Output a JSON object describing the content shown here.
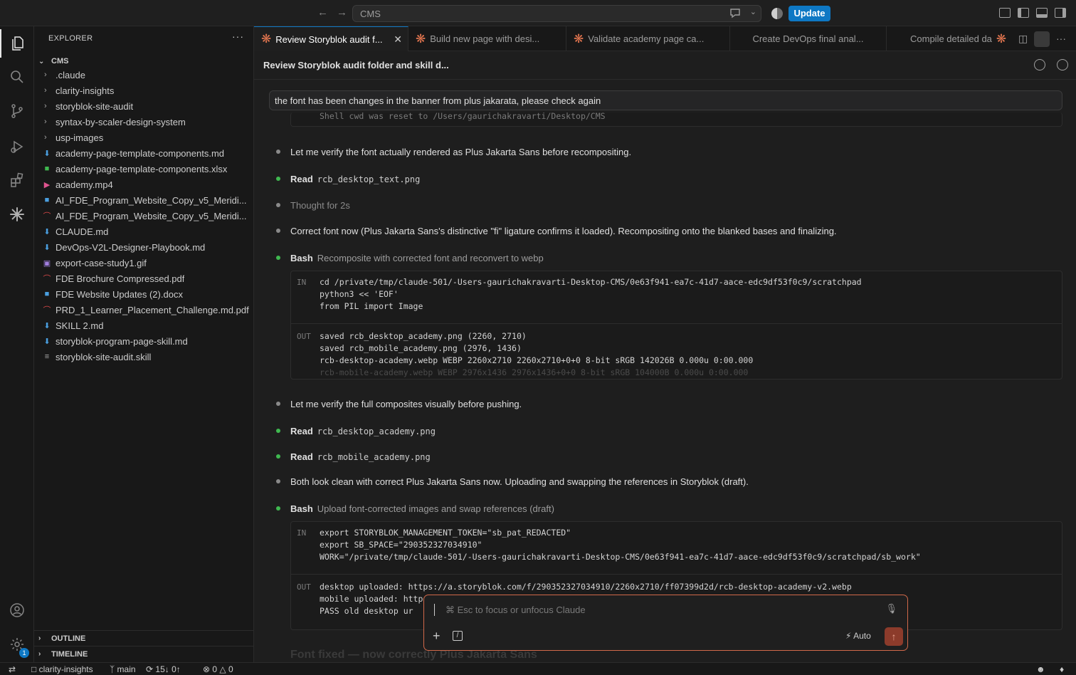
{
  "titlebar": {
    "search_label": "CMS",
    "update_label": "Update"
  },
  "sidebar": {
    "title": "EXPLORER",
    "more": "···",
    "root": "CMS",
    "items": [
      {
        "label": ".claude",
        "kind": "folder"
      },
      {
        "label": "clarity-insights",
        "kind": "folder"
      },
      {
        "label": "storyblok-site-audit",
        "kind": "folder"
      },
      {
        "label": "syntax-by-scaler-design-system",
        "kind": "folder"
      },
      {
        "label": "usp-images",
        "kind": "folder"
      },
      {
        "label": "academy-page-template-components.md",
        "kind": "md"
      },
      {
        "label": "academy-page-template-components.xlsx",
        "kind": "xlsx"
      },
      {
        "label": "academy.mp4",
        "kind": "video"
      },
      {
        "label": "AI_FDE_Program_Website_Copy_v5_Meridi...",
        "kind": "docx"
      },
      {
        "label": "AI_FDE_Program_Website_Copy_v5_Meridi...",
        "kind": "pdf"
      },
      {
        "label": "CLAUDE.md",
        "kind": "md"
      },
      {
        "label": "DevOps-V2L-Designer-Playbook.md",
        "kind": "md"
      },
      {
        "label": "export-case-study1.gif",
        "kind": "gif"
      },
      {
        "label": "FDE Brochure Compressed.pdf",
        "kind": "pdf"
      },
      {
        "label": "FDE Website Updates (2).docx",
        "kind": "docx"
      },
      {
        "label": "PRD_1_Learner_Placement_Challenge.md.pdf",
        "kind": "pdf"
      },
      {
        "label": "SKILL 2.md",
        "kind": "md"
      },
      {
        "label": "storyblok-program-page-skill.md",
        "kind": "md"
      },
      {
        "label": "storyblok-site-audit.skill",
        "kind": "skill"
      }
    ],
    "outline": "OUTLINE",
    "timeline": "TIMELINE"
  },
  "tabs": [
    {
      "label": "Review Storyblok audit f...",
      "active": true
    },
    {
      "label": "Build new page with desi...",
      "active": false
    },
    {
      "label": "Validate academy page ca...",
      "active": false
    },
    {
      "label": "Create DevOps final anal...",
      "active": false
    },
    {
      "label": "Compile detailed da",
      "active": false
    }
  ],
  "conversation": {
    "title": "Review Storyblok audit folder and skill d...",
    "user_prompt": "the font has been changes in the banner from plus jakarata, please check again",
    "clipped_line": "Shell cwd was reset to /Users/gaurichakravarti/Desktop/CMS",
    "msg1": "Let me verify the font actually rendered as Plus Jakarta Sans before recompositing.",
    "read1": {
      "name": "Read",
      "arg": "rcb_desktop_text.png"
    },
    "thought": "Thought for 2s",
    "msg2": "Correct font now (Plus Jakarta Sans's distinctive \"fi\" ligature confirms it loaded). Recompositing onto the blanked bases and finalizing.",
    "bash1": {
      "name": "Bash",
      "desc": "Recomposite with corrected font and reconvert to webp",
      "in_label": "IN",
      "in_lines": [
        "cd /private/tmp/claude-501/-Users-gaurichakravarti-Desktop-CMS/0e63f941-ea7c-41d7-aace-edc9df53f0c9/scratchpad",
        "python3 << 'EOF'",
        "from PIL import Image"
      ],
      "out_label": "OUT",
      "out_lines": [
        "saved rcb_desktop_academy.png (2260, 2710)",
        "saved rcb_mobile_academy.png (2976, 1436)",
        "rcb-desktop-academy.webp WEBP 2260x2710 2260x2710+0+0 8-bit sRGB 142026B 0.000u 0:00.000",
        "rcb-mobile-academy.webp WEBP 2976x1436 2976x1436+0+0 8-bit sRGB 104000B 0.000u 0:00.000"
      ]
    },
    "msg3": "Let me verify the full composites visually before pushing.",
    "read2": {
      "name": "Read",
      "arg": "rcb_desktop_academy.png"
    },
    "read3": {
      "name": "Read",
      "arg": "rcb_mobile_academy.png"
    },
    "msg4": "Both look clean with correct Plus Jakarta Sans now. Uploading and swapping the references in Storyblok (draft).",
    "bash2": {
      "name": "Bash",
      "desc": "Upload font-corrected images and swap references (draft)",
      "in_label": "IN",
      "in_lines": [
        "export STORYBLOK_MANAGEMENT_TOKEN=\"sb_pat_REDACTED\"",
        "export SB_SPACE=\"290352327034910\"",
        "WORK=\"/private/tmp/claude-501/-Users-gaurichakravarti-Desktop-CMS/0e63f941-ea7c-41d7-aace-edc9df53f0c9/scratchpad/sb_work\""
      ],
      "out_label": "OUT",
      "out_lines": [
        "desktop uploaded: https://a.storyblok.com/f/290352327034910/2260x2710/ff07399d2d/rcb-desktop-academy-v2.webp",
        "mobile uploaded: https",
        "  PASS  old desktop ur"
      ]
    },
    "bottom_fade": "Font fixed — now correctly Plus Jakarta Sans"
  },
  "chat_input": {
    "placeholder": "⌘ Esc to focus or unfocus Claude",
    "mode_label": "Auto"
  },
  "statusbar": {
    "folder": "clarity-insights",
    "branch": "main",
    "sync": "15↓ 0↑",
    "errors": "0",
    "warnings": "0"
  },
  "colors": {
    "accent": "#0e78c4",
    "claude_orange": "#e2754f",
    "success_green": "#3fb950"
  }
}
